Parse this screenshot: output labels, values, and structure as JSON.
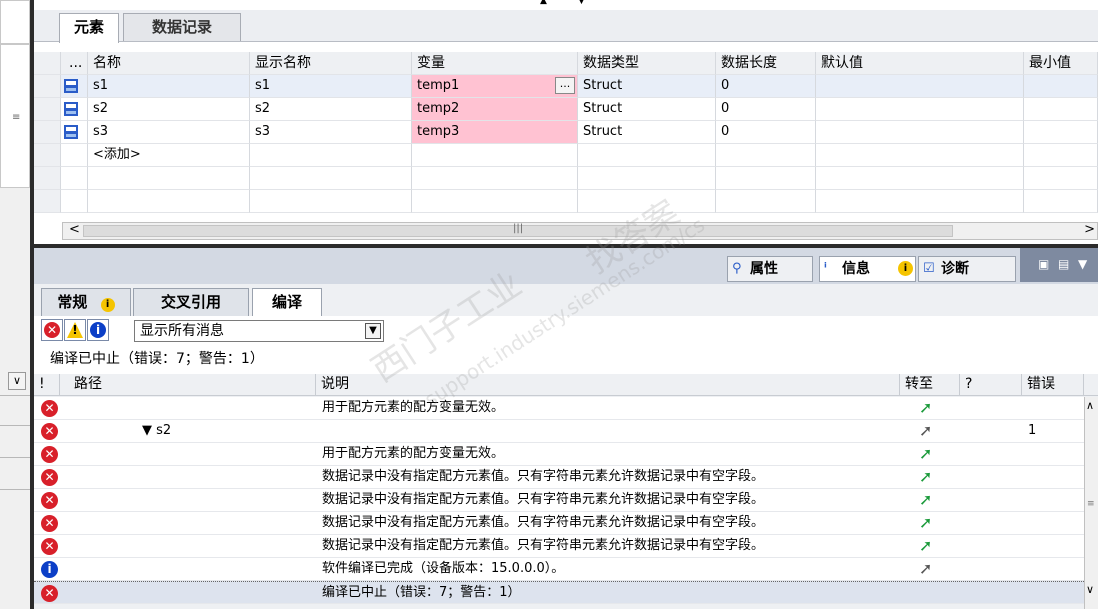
{
  "editor_tabs": [
    "元素",
    "数据记录"
  ],
  "grid": {
    "columns": [
      "...",
      "名称",
      "显示名称",
      "变量",
      "数据类型",
      "数据长度",
      "默认值",
      "最小值"
    ],
    "rows": [
      {
        "name": "s1",
        "display_name": "s1",
        "variable": "temp1",
        "type": "Struct",
        "length": "0"
      },
      {
        "name": "s2",
        "display_name": "s2",
        "variable": "temp2",
        "type": "Struct",
        "length": "0"
      },
      {
        "name": "s3",
        "display_name": "s3",
        "variable": "temp3",
        "type": "Struct",
        "length": "0"
      }
    ],
    "add_label": "<添加>",
    "browse_button": "..."
  },
  "inspector": {
    "tabs": [
      "属性",
      "信息",
      "诊断"
    ],
    "sub_tabs": [
      "常规",
      "交叉引用",
      "编译"
    ],
    "filter_select": "显示所有消息",
    "status": "编译已中止（错误：7；警告：1）",
    "columns": [
      "!",
      "路径",
      "说明",
      "转至",
      "?",
      "错误"
    ],
    "messages": [
      {
        "type": "error",
        "path": "",
        "desc": "用于配方元素的配方变量无效。",
        "errors": "",
        "goto": "green"
      },
      {
        "type": "error",
        "path": "▼ s2",
        "desc": "",
        "errors": "1",
        "goto": "gray"
      },
      {
        "type": "error",
        "path": "",
        "desc": "用于配方元素的配方变量无效。",
        "errors": "",
        "goto": "green"
      },
      {
        "type": "error",
        "path": "",
        "desc": "数据记录中没有指定配方元素值。只有字符串元素允许数据记录中有空字段。",
        "errors": "",
        "goto": "green"
      },
      {
        "type": "error",
        "path": "",
        "desc": "数据记录中没有指定配方元素值。只有字符串元素允许数据记录中有空字段。",
        "errors": "",
        "goto": "green"
      },
      {
        "type": "error",
        "path": "",
        "desc": "数据记录中没有指定配方元素值。只有字符串元素允许数据记录中有空字段。",
        "errors": "",
        "goto": "green"
      },
      {
        "type": "error",
        "path": "",
        "desc": "数据记录中没有指定配方元素值。只有字符串元素允许数据记录中有空字段。",
        "errors": "",
        "goto": "green"
      },
      {
        "type": "info",
        "path": "",
        "desc": "软件编译已完成（设备版本：15.0.0.0）。",
        "errors": "",
        "goto": "gray"
      },
      {
        "type": "error",
        "path": "",
        "desc": "编译已中止（错误：7；警告：1）",
        "errors": "",
        "goto": "none"
      }
    ]
  },
  "watermark": [
    "西门子工业",
    "找答案",
    "support.industry.siemens.com/cs"
  ],
  "colors": {
    "pink": "#ffc2d2",
    "error": "#d8202a",
    "info": "#0c3fc7",
    "warn": "#f5c400",
    "goto_green": "#1a9a3a"
  }
}
